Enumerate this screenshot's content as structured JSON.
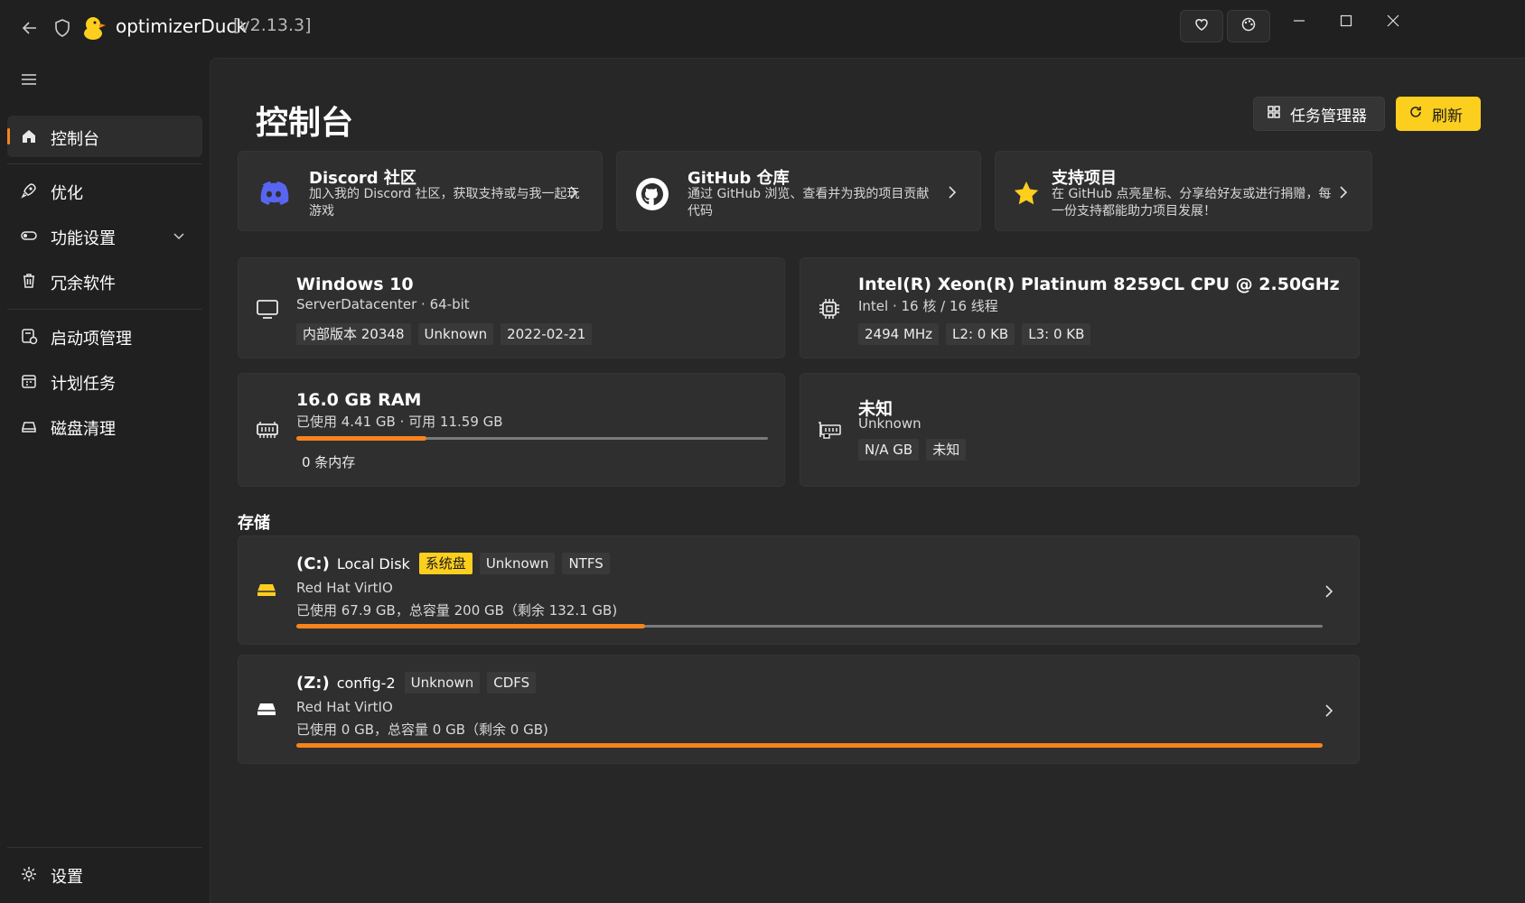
{
  "app": {
    "title": "optimizerDuck",
    "version": "[v2.13.3]"
  },
  "sidebar": {
    "items": [
      {
        "label": "控制台",
        "icon": "home-icon",
        "active": true
      },
      {
        "label": "优化",
        "icon": "rocket-icon"
      },
      {
        "label": "功能设置",
        "icon": "toggle-icon"
      },
      {
        "label": "冗余软件",
        "icon": "trash-icon"
      },
      {
        "label": "启动项管理",
        "icon": "startup-icon"
      },
      {
        "label": "计划任务",
        "icon": "calendar-icon"
      },
      {
        "label": "磁盘清理",
        "icon": "drive-icon"
      }
    ],
    "settings_label": "设置"
  },
  "header": {
    "title": "控制台",
    "task_manager_label": "任务管理器",
    "refresh_label": "刷新"
  },
  "links": [
    {
      "title": "Discord 社区",
      "desc": "加入我的 Discord 社区，获取支持或与我一起玩游戏",
      "icon": "discord-icon"
    },
    {
      "title": "GitHub 仓库",
      "desc": "通过 GitHub 浏览、查看并为我的项目贡献代码",
      "icon": "github-icon"
    },
    {
      "title": "支持项目",
      "desc": "在 GitHub 点亮星标、分享给好友或进行捐赠，每一份支持都能助力项目发展！",
      "icon": "star-icon"
    }
  ],
  "system": {
    "os": {
      "title": "Windows 10",
      "sub": "ServerDatacenter · 64-bit",
      "tags": [
        "内部版本 20348",
        "Unknown",
        "2022-02-21"
      ]
    },
    "cpu": {
      "title": "Intel(R) Xeon(R) Platinum 8259CL CPU @ 2.50GHz",
      "sub": "Intel · 16 核 / 16 线程",
      "tags": [
        "2494 MHz",
        "L2: 0 KB",
        "L3: 0 KB"
      ]
    },
    "ram": {
      "title": "16.0 GB RAM",
      "sub": "已使用 4.41 GB · 可用 11.59 GB",
      "used_fraction": 0.276,
      "tags": [
        "0 条内存"
      ]
    },
    "gpu": {
      "title": "未知",
      "sub": "Unknown",
      "tags": [
        "N/A GB",
        "未知"
      ]
    }
  },
  "storage": {
    "label": "存储",
    "drives": [
      {
        "letter": "(C:)",
        "name": "Local Disk",
        "tags": [
          {
            "text": "系统盘",
            "highlight": true
          },
          {
            "text": "Unknown"
          },
          {
            "text": "NTFS"
          }
        ],
        "model": "Red Hat VirtIO",
        "usage": "已使用 67.9 GB，总容量 200 GB（剩余 132.1 GB)",
        "used_fraction": 0.34,
        "icon_color": "#fccf1e"
      },
      {
        "letter": "(Z:)",
        "name": "config-2",
        "tags": [
          {
            "text": "Unknown"
          },
          {
            "text": "CDFS"
          }
        ],
        "model": "Red Hat VirtIO",
        "usage": "已使用 0 GB，总容量 0 GB（剩余 0 GB)",
        "used_fraction": 1.0,
        "icon_color": "#ffffff"
      }
    ]
  },
  "colors": {
    "accent": "#f7831d",
    "yellow": "#fccf1e",
    "discord": "#5865f2"
  }
}
